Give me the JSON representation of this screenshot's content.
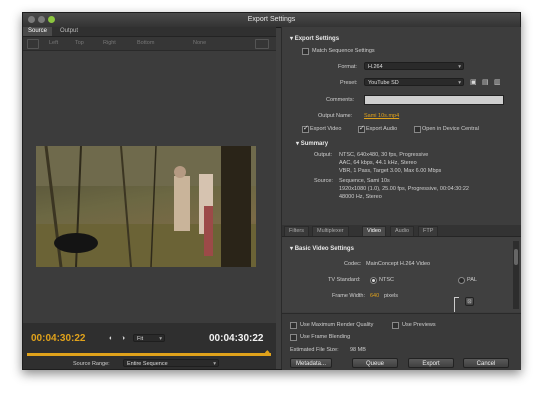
{
  "window": {
    "title": "Export Settings"
  },
  "source_tabs": [
    "Source",
    "Output"
  ],
  "crop": {
    "left": "Left",
    "top": "Top",
    "right": "Right",
    "bottom": "Bottom",
    "ratio": "None"
  },
  "timeline": {
    "current": "00:04:30:22",
    "duration": "00:04:30:22",
    "fit": "Fit",
    "source_range_label": "Source Range:",
    "source_range_value": "Entire Sequence"
  },
  "export": {
    "section": "Export Settings",
    "match_seq": "Match Sequence Settings",
    "format_label": "Format:",
    "format_value": "H.264",
    "preset_label": "Preset:",
    "preset_value": "YouTube SD",
    "comments_label": "Comments:",
    "output_label": "Output Name:",
    "output_value": "Sami 10s.mp4",
    "export_video": "Export Video",
    "export_audio": "Export Audio",
    "open_device": "Open in Device Central"
  },
  "summary": {
    "title": "Summary",
    "output_label": "Output:",
    "output_lines": [
      "NTSC, 640x480, 30 fps, Progressive",
      "AAC, 64 kbps, 44.1 kHz, Stereo",
      "VBR, 1 Pass, Target 3.00, Max 6.00 Mbps"
    ],
    "source_label": "Source:",
    "source_lines": [
      "Sequence, Sami 10s",
      "1920x1080 (1.0), 25.00 fps, Progressive, 00:04:30:22",
      "48000 Hz, Stereo"
    ]
  },
  "panel_tabs": [
    "Filters",
    "Multiplexer",
    "Video",
    "Audio",
    "FTP"
  ],
  "video": {
    "section": "Basic Video Settings",
    "codec_label": "Codec:",
    "codec_value": "MainConcept H.264 Video",
    "tv_label": "TV Standard:",
    "ntsc": "NTSC",
    "pal": "PAL",
    "fw_label": "Frame Width:",
    "fw_value": "640",
    "fw_unit": "pixels"
  },
  "options": {
    "max_render": "Use Maximum Render Quality",
    "previews": "Use Previews",
    "frame_blend": "Use Frame Blending",
    "file_size_label": "Estimated File Size:",
    "file_size_value": "98 MB"
  },
  "buttons": {
    "metadata": "Metadata...",
    "queue": "Queue",
    "export": "Export",
    "cancel": "Cancel"
  },
  "colors": {
    "accent": "#e0a21b"
  }
}
